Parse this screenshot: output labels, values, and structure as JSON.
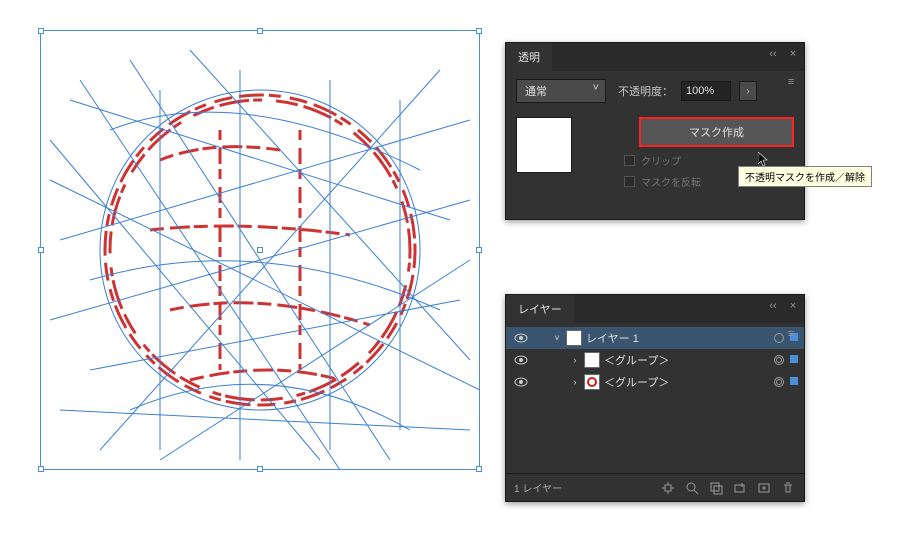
{
  "transparency": {
    "tab_label": "透明",
    "blend_mode": "通常",
    "opacity_label": "不透明度：",
    "opacity_value": "100%",
    "make_mask_label": "マスク作成",
    "clip_label": "クリップ",
    "invert_label": "マスクを反転",
    "tooltip_text": "不透明マスクを作成／解除"
  },
  "layers": {
    "tab_label": "レイヤー",
    "rows": [
      {
        "name": "レイヤー 1",
        "expanded": true,
        "selected": true,
        "indent": 0
      },
      {
        "name": "＜グループ＞",
        "expanded": false,
        "selected": false,
        "indent": 1,
        "thumb": "white"
      },
      {
        "name": "＜グループ＞",
        "expanded": false,
        "selected": false,
        "indent": 1,
        "thumb": "red"
      }
    ],
    "footer_count": "1 レイヤー"
  },
  "icons": {
    "collapse": "‹‹",
    "close": "×",
    "menu": "≡",
    "eye_title": "visibility",
    "disclosure_open": "˅",
    "disclosure_closed": "›",
    "caret_right": "›"
  }
}
